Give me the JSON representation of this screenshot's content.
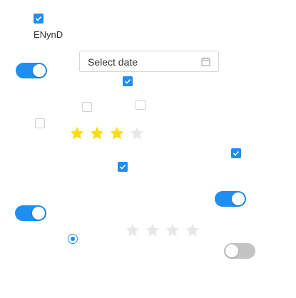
{
  "checkbox_label": "ENynD",
  "date_picker": {
    "placeholder": "Select date",
    "icon": "calendar-icon"
  },
  "checkboxes": [
    {
      "id": "cb-label",
      "checked": true
    },
    {
      "id": "cb-1",
      "checked": true
    },
    {
      "id": "cb-2",
      "checked": false
    },
    {
      "id": "cb-3",
      "checked": false
    },
    {
      "id": "cb-4",
      "checked": false
    },
    {
      "id": "cb-5",
      "checked": true
    },
    {
      "id": "cb-6",
      "checked": true
    }
  ],
  "toggles": [
    {
      "id": "toggle-1",
      "on": true
    },
    {
      "id": "toggle-2",
      "on": true
    },
    {
      "id": "toggle-3",
      "on": true
    },
    {
      "id": "toggle-4",
      "on": false
    }
  ],
  "ratings": [
    {
      "id": "rating-1",
      "value": 3,
      "max": 4
    },
    {
      "id": "rating-2",
      "value": 0,
      "max": 4
    }
  ],
  "radio": {
    "selected": true
  },
  "colors": {
    "accent": "#1f8ef1",
    "star_on": "#fadb14",
    "star_off": "#e8e8e8",
    "toggle_off": "#c4c4c4"
  }
}
